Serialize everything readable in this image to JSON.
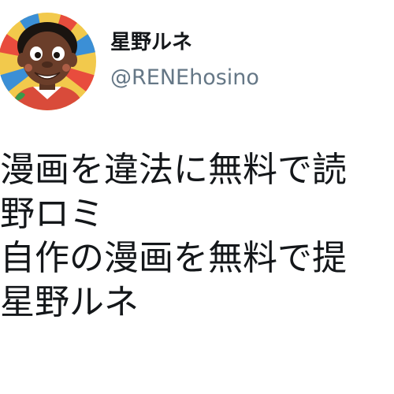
{
  "author": {
    "display_name": "星野ルネ",
    "handle": "@RENEhosino",
    "avatar_icon": "cartoon-avatar-icon"
  },
  "tweet": {
    "lines": [
      "漫画を違法に無料で読",
      "野ロミ",
      "自作の漫画を無料で提",
      "星野ルネ"
    ]
  },
  "colors": {
    "text": "#14171a",
    "handle": "#657786",
    "background": "#ffffff"
  }
}
